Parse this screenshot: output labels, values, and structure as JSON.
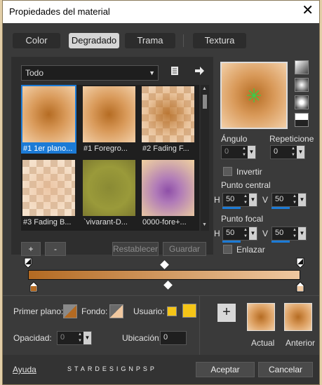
{
  "window": {
    "title": "Propiedades del material",
    "close_glyph": "✕"
  },
  "tabs": [
    {
      "label": "Color",
      "active": false
    },
    {
      "label": "Degradado",
      "active": true
    },
    {
      "label": "Trama",
      "active": false
    },
    {
      "label": "Textura",
      "active": false
    }
  ],
  "library": {
    "category": "Todo",
    "items": [
      {
        "label": "#1 1er plano...",
        "selected": true
      },
      {
        "label": "#1 Foregro...",
        "selected": false
      },
      {
        "label": "#2 Fading F...",
        "selected": false
      },
      {
        "label": "#3 Fading B...",
        "selected": false
      },
      {
        "label": "`vivarant-D...",
        "selected": false
      },
      {
        "label": "0000-fore+...",
        "selected": false
      }
    ],
    "add_label": "+",
    "remove_label": "-",
    "reset_label": "Restablecer",
    "save_label": "Guardar"
  },
  "gradient": {
    "angle_label": "Ángulo",
    "angle_value": "0",
    "repeat_label": "Repeticione",
    "repeat_value": "0",
    "invert_label": "Invertir",
    "center_label": "Punto central",
    "center_h": "50",
    "center_v": "50",
    "focal_label": "Punto focal",
    "focal_h": "50",
    "focal_v": "50",
    "link_label": "Enlazar",
    "h_label": "H",
    "v_label": "V",
    "colors": {
      "start": "#b36a22",
      "end": "#f0c8a0"
    }
  },
  "bottom": {
    "foreground_label": "Primer plano:",
    "background_label": "Fondo:",
    "user_label": "Usuario:",
    "opacity_label": "Opacidad:",
    "opacity_value": "0",
    "location_label": "Ubicación:",
    "location_value": "0",
    "add_label": "+",
    "current_label": "Actual",
    "previous_label": "Anterior",
    "user_color": "#f5c517"
  },
  "footer": {
    "help_label": "Ayuda",
    "watermark": "STARDESIGNPSP",
    "ok_label": "Aceptar",
    "cancel_label": "Cancelar"
  }
}
